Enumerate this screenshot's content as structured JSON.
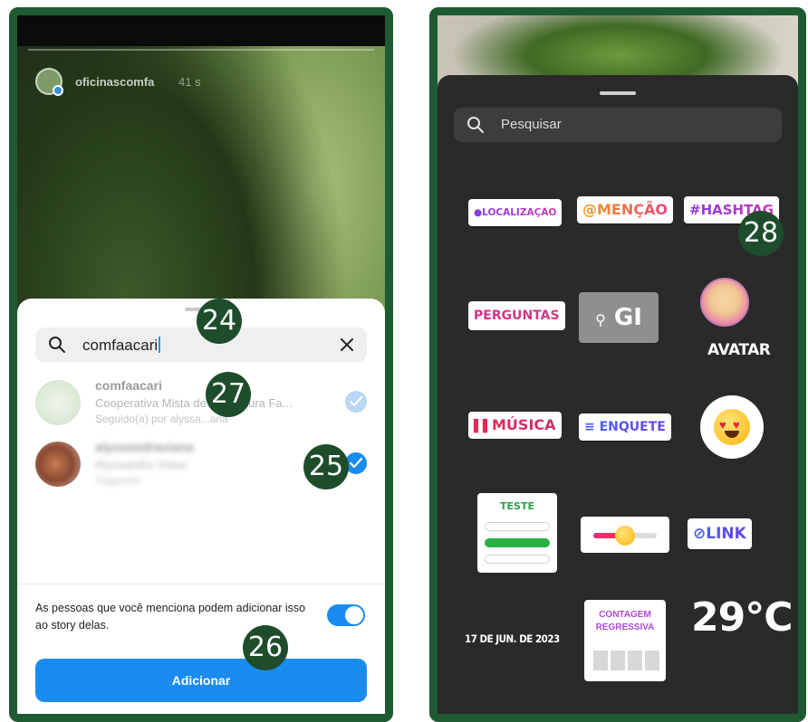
{
  "left": {
    "story": {
      "username": "oficinascomfa",
      "time": "41 s"
    },
    "search": {
      "query": "comfaacari"
    },
    "results": [
      {
        "name": "comfaacari",
        "subtitle": "Cooperativa Mista de Agricultura Fa...",
        "meta": "Seguido(a) por alyssa...ana",
        "selected": false
      },
      {
        "name": "alyssandraviana",
        "subtitle": "Alyssandra Viana",
        "meta": "Seguindo",
        "selected": true
      }
    ],
    "notice": "As pessoas que você menciona podem adicionar isso ao story delas.",
    "add_button": "Adicionar"
  },
  "right": {
    "search_placeholder": "Pesquisar",
    "stickers": {
      "location": "LOCALIZAÇÃO",
      "mention": "@MENÇÃO",
      "hashtag": "#HASHTAG",
      "questions": "PERGUNTAS",
      "gif": "GI",
      "avatar": "AVATAR",
      "music": "MÚSICA",
      "poll": "ENQUETE",
      "quiz": "TESTE",
      "link": "LINK",
      "date": "17 DE JUN. DE 2023",
      "countdown_line1": "CONTAGEM",
      "countdown_line2": "REGRESSIVA",
      "temperature": "29°C"
    }
  },
  "badges": {
    "b24": "24",
    "b25": "25",
    "b26": "26",
    "b27": "27",
    "b28": "28"
  },
  "colors": {
    "accent": "#1a8cf0",
    "frame": "#1e5a32",
    "badge": "#1e4d2c"
  }
}
